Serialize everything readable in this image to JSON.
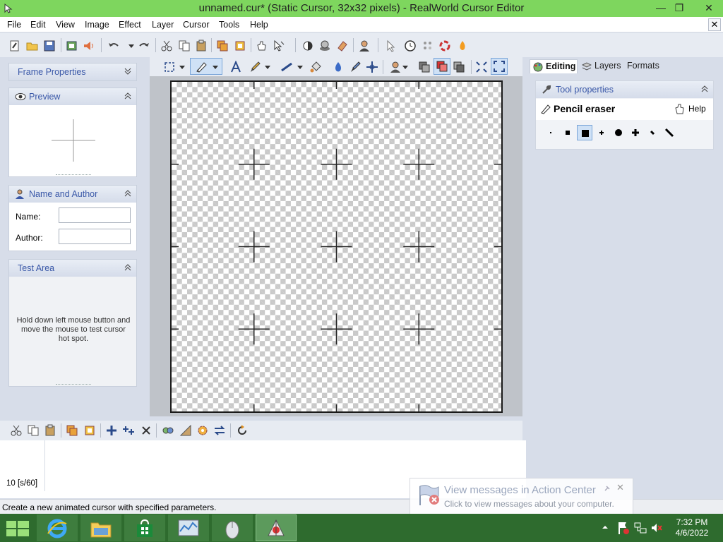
{
  "window": {
    "title": "unnamed.cur* (Static Cursor, 32x32 pixels) - RealWorld Cursor Editor",
    "minimize_glyph": "—",
    "restore_glyph": "❐",
    "close_glyph": "✕"
  },
  "menu": {
    "items": [
      "File",
      "Edit",
      "View",
      "Image",
      "Effect",
      "Layer",
      "Cursor",
      "Tools",
      "Help"
    ],
    "doc_close_glyph": "✕"
  },
  "left_panels": {
    "frame_properties": {
      "title": "Frame Properties"
    },
    "preview": {
      "title": "Preview"
    },
    "name_author": {
      "title": "Name and Author",
      "name_label": "Name:",
      "name_value": "",
      "author_label": "Author:",
      "author_value": ""
    },
    "test_area": {
      "title": "Test Area",
      "hint": "Hold down left mouse button and move the mouse to test cursor hot spot."
    }
  },
  "right_panel": {
    "tabs": [
      "Editing",
      "Layers",
      "Formats"
    ],
    "active_tab": "Editing",
    "tool_properties_title": "Tool properties",
    "tool_name": "Pencil eraser",
    "help_label": "Help",
    "brush_sizes_count": 8,
    "selected_brush_index": 2
  },
  "frames": {
    "frame_label": "10 [s/60]"
  },
  "status": {
    "text": "Create a new animated cursor with specified parameters."
  },
  "notification": {
    "title": "View messages in Action Center",
    "body": "Click to view messages about your computer."
  },
  "taskbar": {
    "time": "7:32 PM",
    "date": "4/6/2022",
    "apps": [
      "start",
      "internet-explorer",
      "file-explorer",
      "store",
      "task-manager",
      "mouse-settings",
      "realworld-cursor-editor"
    ]
  },
  "colors": {
    "titlebar": "#7ed65e",
    "panel_title": "#3a58a8",
    "taskbar": "#2e6b2e"
  }
}
